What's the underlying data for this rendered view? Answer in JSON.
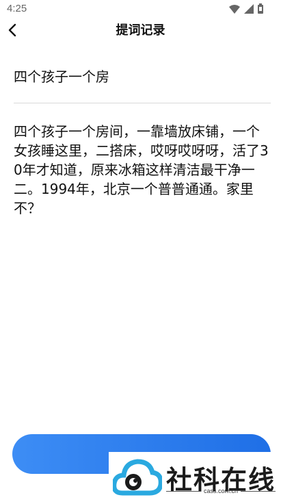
{
  "status_bar": {
    "time": "4:25",
    "icons": [
      "wifi-icon",
      "signal-icon",
      "battery-icon"
    ]
  },
  "header": {
    "title": "提词记录",
    "back_icon": "chevron-left-icon"
  },
  "editor": {
    "title_value": "四个孩子一个房",
    "body_text": "四个孩子一个房间，一靠墙放床铺，一个女孩睡这里，二搭床，哎呀哎呀呀，活了30年才知道，原来冰箱这样清洁最干净一二。1994年，北京一个普普通通。家里不？"
  },
  "footer": {
    "button_label": "",
    "accent_color": "#2f80ed"
  },
  "watermark": {
    "name": "社科在线",
    "domain": "cass.com.cn",
    "colors": {
      "logo": "#2aa9e0",
      "text": "#1b1b1b"
    }
  }
}
